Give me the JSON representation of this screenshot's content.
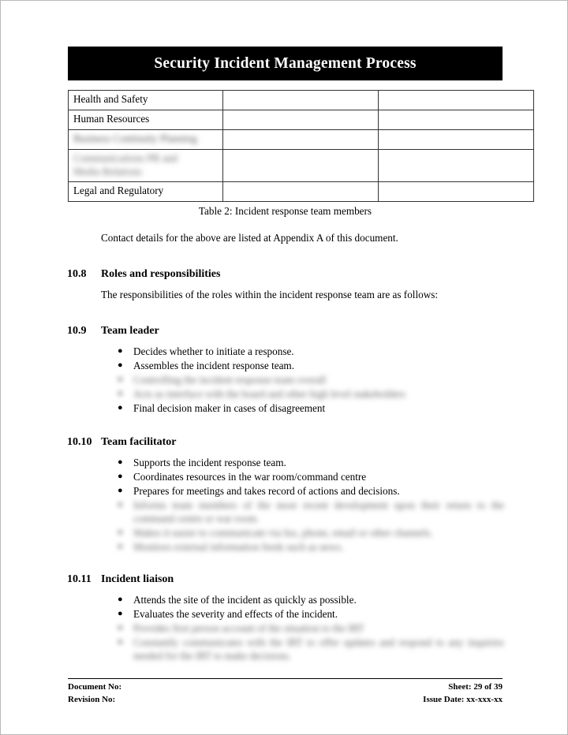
{
  "document": {
    "title": "Security Incident Management Process"
  },
  "table": {
    "caption": "Table 2: Incident response team members",
    "rows": [
      {
        "name": "Health and Safety",
        "redacted": false,
        "lines": []
      },
      {
        "name": "Human Resources",
        "redacted": false,
        "lines": []
      },
      {
        "name": "Business Continuity Planning",
        "redacted": true,
        "lines": [
          "Business Continuity Planning"
        ]
      },
      {
        "name": "Communications PR and Media Relations",
        "redacted": true,
        "lines": [
          "Communications PR and",
          "Media Relations"
        ]
      },
      {
        "name": "Legal and Regulatory",
        "redacted": false,
        "lines": []
      }
    ]
  },
  "body": {
    "contact_note": "Contact details for the above are listed at Appendix A of this document."
  },
  "sections": [
    {
      "number": "10.8",
      "title": "Roles and responsibilities",
      "intro": "The responsibilities of the roles within the incident response team are as follows:",
      "bullets": []
    },
    {
      "number": "10.9",
      "title": "Team leader",
      "intro": "",
      "bullets": [
        {
          "text": "Decides whether to initiate a response.",
          "redacted": false
        },
        {
          "text": "Assembles the incident response team.",
          "redacted": false
        },
        {
          "text": "Controlling the incident response team overall",
          "redacted": true
        },
        {
          "text": "Acts as interface with the board and other high level stakeholders",
          "redacted": true
        },
        {
          "text": "Final decision maker in cases of disagreement",
          "redacted": false
        }
      ]
    },
    {
      "number": "10.10",
      "title": "Team facilitator",
      "intro": "",
      "bullets": [
        {
          "text": "Supports the incident response team.",
          "redacted": false
        },
        {
          "text": "Coordinates resources in the war room/command centre",
          "redacted": false
        },
        {
          "text": "Prepares for meetings and takes record of actions and decisions.",
          "redacted": false
        },
        {
          "text": "Informs team members of the most recent development upon their return to the command centre or war room.",
          "redacted": true
        },
        {
          "text": "Makes it easier to communicate via fax, phone, email or other channels.",
          "redacted": true
        },
        {
          "text": "Monitors external information feeds such as news.",
          "redacted": true
        }
      ]
    },
    {
      "number": "10.11",
      "title": "Incident liaison",
      "intro": "",
      "bullets": [
        {
          "text": "Attends the site of the incident as quickly as possible.",
          "redacted": false
        },
        {
          "text": "Evaluates the severity and effects of the incident.",
          "redacted": false
        },
        {
          "text": "Provides first person account of the situation to the IRT",
          "redacted": true
        },
        {
          "text": "Constantly communicates with the IRT to offer updates and respond to any inquiries needed for the IRT to make decisions.",
          "redacted": true
        }
      ]
    }
  ],
  "footer": {
    "document_no": "Document No:",
    "revision_no": "Revision No:",
    "sheet": "Sheet: 29 of 39",
    "issue_date": "Issue Date: xx-xxx-xx"
  },
  "bullet_glyph": "●"
}
